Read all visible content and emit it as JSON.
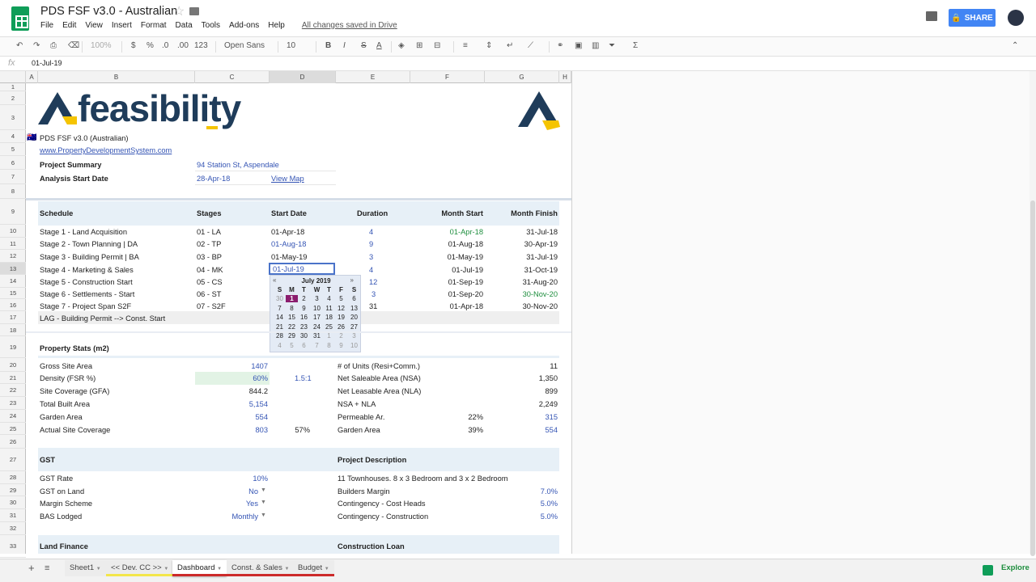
{
  "doc": {
    "title": "PDS FSF v3.0 - Australian",
    "saved": "All changes saved in Drive",
    "share": "SHARE"
  },
  "menu": [
    "File",
    "Edit",
    "View",
    "Insert",
    "Format",
    "Data",
    "Tools",
    "Add-ons",
    "Help"
  ],
  "toolbar": {
    "zoom": "100%",
    "currency": "$",
    "percent": "%",
    "dec_less": ".0",
    "dec_more": ".00",
    "more_formats": "123",
    "font": "Open Sans",
    "size": "10",
    "bold": "B",
    "italic": "I",
    "strike": "S",
    "textcolor": "A",
    "sum": "Σ"
  },
  "formula": {
    "value": "01-Jul-19"
  },
  "columns": [
    "A",
    "B",
    "C",
    "D",
    "E",
    "F",
    "G",
    "H"
  ],
  "rows": [
    "1",
    "2",
    "3",
    "4",
    "5",
    "6",
    "7",
    "8",
    "9",
    "10",
    "11",
    "12",
    "13",
    "14",
    "15",
    "16",
    "17",
    "18",
    "19",
    "20",
    "21",
    "22",
    "23",
    "24",
    "25",
    "26",
    "27",
    "28",
    "29",
    "30",
    "31",
    "32",
    "33"
  ],
  "logo": {
    "text": "feasibility"
  },
  "info": {
    "version": "PDS FSF v3.0 (Australian)",
    "website": "www.PropertyDevelopmentSystem.com",
    "project_label": "Project Summary",
    "project_value": "94 Station St, Aspendale",
    "start_label": "Analysis Start Date",
    "start_value": "28-Apr-18",
    "map_link": "View Map"
  },
  "schedule": {
    "headers": [
      "Schedule",
      "Stages",
      "Start Date",
      "Duration",
      "Month Start",
      "Month Finish"
    ],
    "rows": [
      [
        "Stage 1 - Land Acquisition",
        "01 - LA",
        "01-Apr-18",
        "4",
        "01-Apr-18",
        "31-Jul-18"
      ],
      [
        "Stage 2 - Town Planning | DA",
        "02 - TP",
        "01-Aug-18",
        "9",
        "01-Aug-18",
        "30-Apr-19"
      ],
      [
        "Stage 3 - Building Permit | BA",
        "03 - BP",
        "01-May-19",
        "3",
        "01-May-19",
        "31-Jul-19"
      ],
      [
        "Stage 4 - Marketing & Sales",
        "04 - MK",
        "01-Jul-19",
        "4",
        "01-Jul-19",
        "31-Oct-19"
      ],
      [
        "Stage 5 - Construction Start",
        "05 - CS",
        "",
        "12",
        "01-Sep-19",
        "31-Aug-20"
      ],
      [
        "Stage 6 - Settlements - Start",
        "06 - ST",
        "",
        "3",
        "01-Sep-20",
        "30-Nov-20"
      ],
      [
        "Stage 7 - Project Span S2F",
        "07 - S2F",
        "",
        "31",
        "01-Apr-18",
        "30-Nov-20"
      ]
    ],
    "lag": "LAG - Building Permit --> Const. Start"
  },
  "calendar": {
    "month": "July 2019",
    "prev": "«",
    "next": "»",
    "days": [
      "S",
      "M",
      "T",
      "W",
      "T",
      "F",
      "S"
    ],
    "weeks": [
      [
        "30",
        "1",
        "2",
        "3",
        "4",
        "5",
        "6"
      ],
      [
        "7",
        "8",
        "9",
        "10",
        "11",
        "12",
        "13"
      ],
      [
        "14",
        "15",
        "16",
        "17",
        "18",
        "19",
        "20"
      ],
      [
        "21",
        "22",
        "23",
        "24",
        "25",
        "26",
        "27"
      ],
      [
        "28",
        "29",
        "30",
        "31",
        "1",
        "2",
        "3"
      ],
      [
        "4",
        "5",
        "6",
        "7",
        "8",
        "9",
        "10"
      ]
    ]
  },
  "editing": {
    "value": "01-Jul-19"
  },
  "stats": {
    "title": "Property Stats (m2)",
    "left": [
      {
        "label": "Gross Site Area",
        "value": "1407",
        "extra": ""
      },
      {
        "label": "Density (FSR %)",
        "value": "60%",
        "extra": "1.5:1"
      },
      {
        "label": "Site Coverage (GFA)",
        "value": "844.2",
        "extra": ""
      },
      {
        "label": "Total Built Area",
        "value": "5,154",
        "extra": ""
      },
      {
        "label": "Garden Area",
        "value": "554",
        "extra": ""
      },
      {
        "label": "Actual Site Coverage",
        "value": "803",
        "extra": "57%"
      }
    ],
    "right": [
      {
        "label": "# of Units (Resi+Comm.)",
        "pct": "",
        "value": "11"
      },
      {
        "label": "Net Saleable Area (NSA)",
        "pct": "",
        "value": "1,350"
      },
      {
        "label": "Net Leasable Area (NLA)",
        "pct": "",
        "value": "899"
      },
      {
        "label": "NSA + NLA",
        "pct": "",
        "value": "2,249"
      },
      {
        "label": "Permeable Ar.",
        "pct": "22%",
        "value": "315"
      },
      {
        "label": "Garden Area",
        "pct": "39%",
        "value": "554"
      }
    ]
  },
  "gst": {
    "title": "GST",
    "rows": [
      {
        "label": "GST Rate",
        "value": "10%"
      },
      {
        "label": "GST on Land",
        "value": "No"
      },
      {
        "label": "Margin Scheme",
        "value": "Yes"
      },
      {
        "label": "BAS Lodged",
        "value": "Monthly"
      }
    ]
  },
  "project": {
    "title": "Project Description",
    "description": "11 Townhouses. 8 x 3 Bedroom and 3 x 2 Bedroom",
    "rows": [
      {
        "label": "Builders Margin",
        "value": "7.0%"
      },
      {
        "label": "Contingency - Cost Heads",
        "value": "5.0%"
      },
      {
        "label": "Contingency - Construction",
        "value": "5.0%"
      }
    ]
  },
  "sections": {
    "land_finance": "Land Finance",
    "construction_loan": "Construction Loan"
  },
  "tabs": [
    {
      "label": "Sheet1",
      "color": ""
    },
    {
      "label": "<< Dev. CC >>",
      "color": "#f3e64a"
    },
    {
      "label": "Dashboard",
      "color": "#cc2a2a"
    },
    {
      "label": "Const. & Sales",
      "color": "#cc2a2a"
    },
    {
      "label": "Budget",
      "color": "#cc2a2a"
    }
  ],
  "explore": "Explore"
}
